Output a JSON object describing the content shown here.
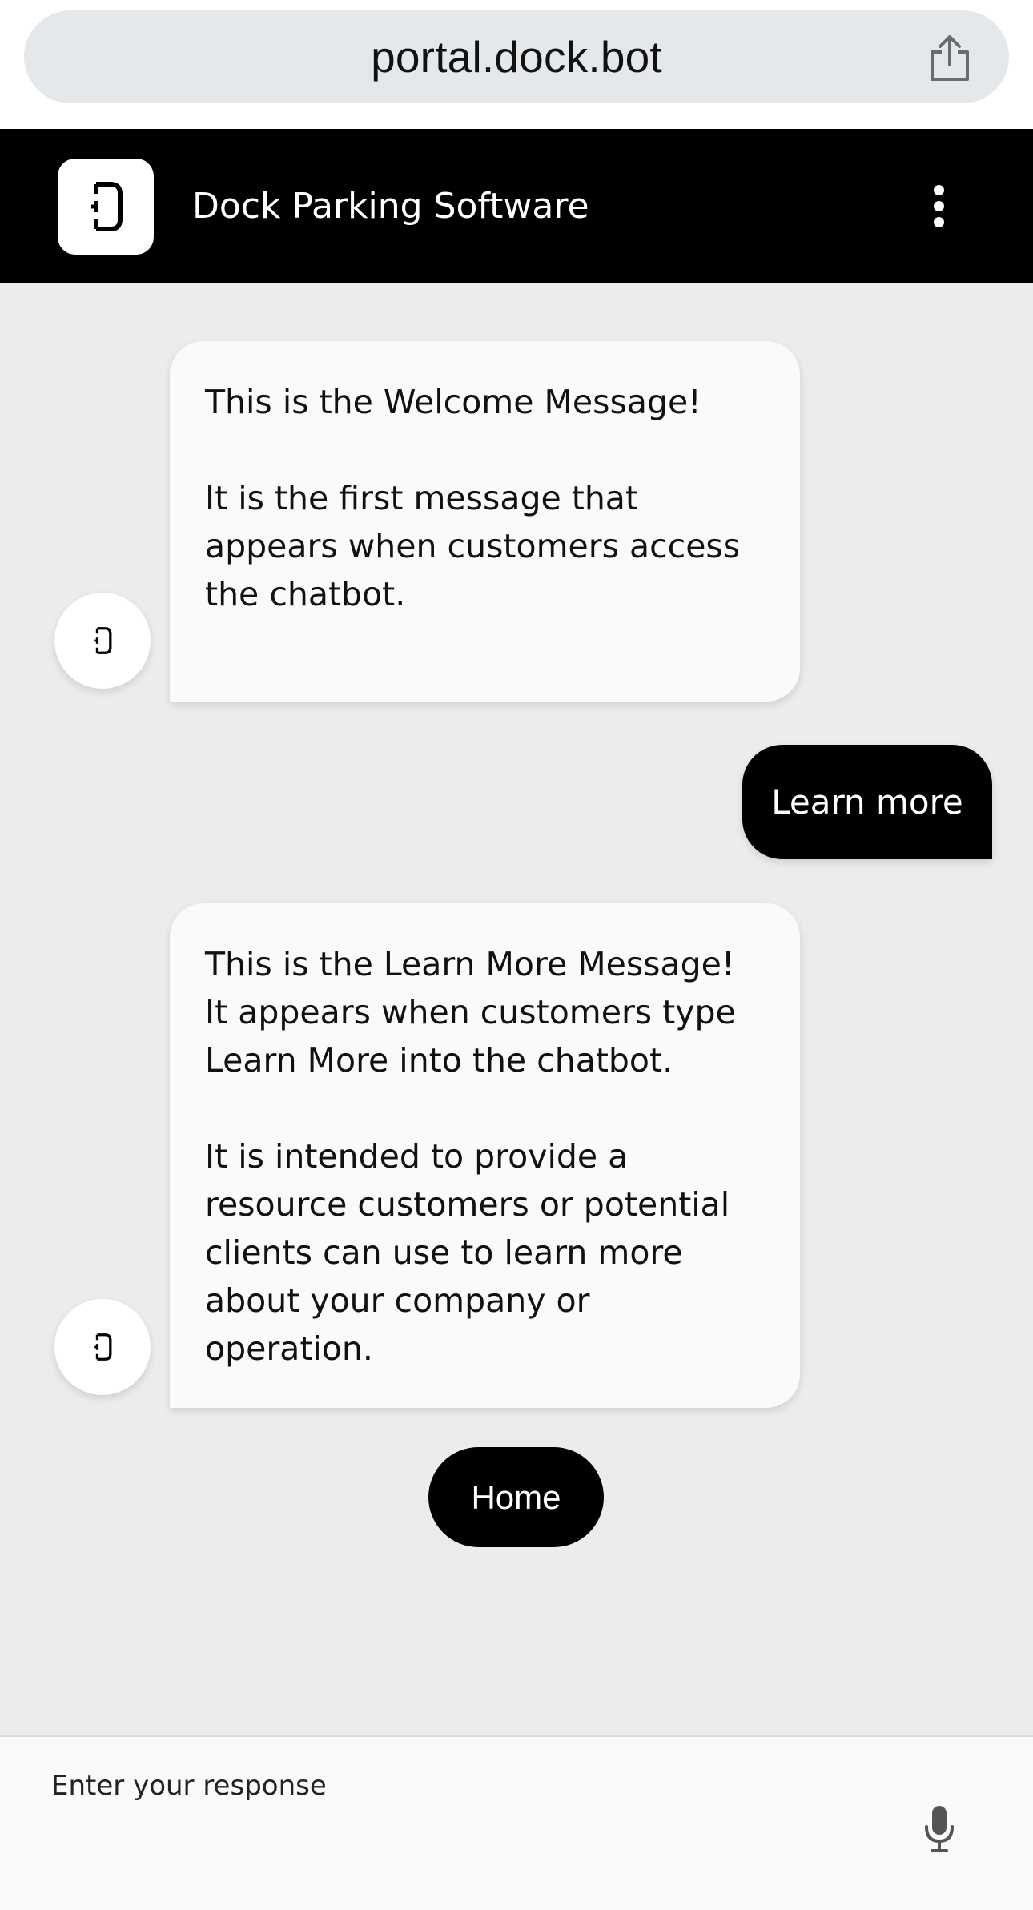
{
  "browser": {
    "url": "portal.dock.bot",
    "share_icon": "share-icon"
  },
  "header": {
    "title": "Dock Parking Software",
    "logo_icon": "dock-logo-icon",
    "menu_icon": "more-vertical-icon"
  },
  "messages": [
    {
      "sender": "bot",
      "text": "This is the Welcome Message!\n\nIt is the first message that appears when customers access the chatbot."
    },
    {
      "sender": "user",
      "text": "Learn more"
    },
    {
      "sender": "bot",
      "text": "This is the Learn More Message! It appears when customers type Learn More into the chatbot.\n\nIt is intended to provide a resource customers or potential clients can use to learn more about your company or operation."
    }
  ],
  "quick_reply": {
    "label": "Home"
  },
  "input": {
    "placeholder": "Enter your response",
    "mic_icon": "microphone-icon"
  },
  "colors": {
    "header_bg": "#000000",
    "chat_bg": "#ececec",
    "bot_bubble": "#fafafa",
    "user_bubble": "#000000",
    "urlbar_bg": "#e5e8eb"
  }
}
